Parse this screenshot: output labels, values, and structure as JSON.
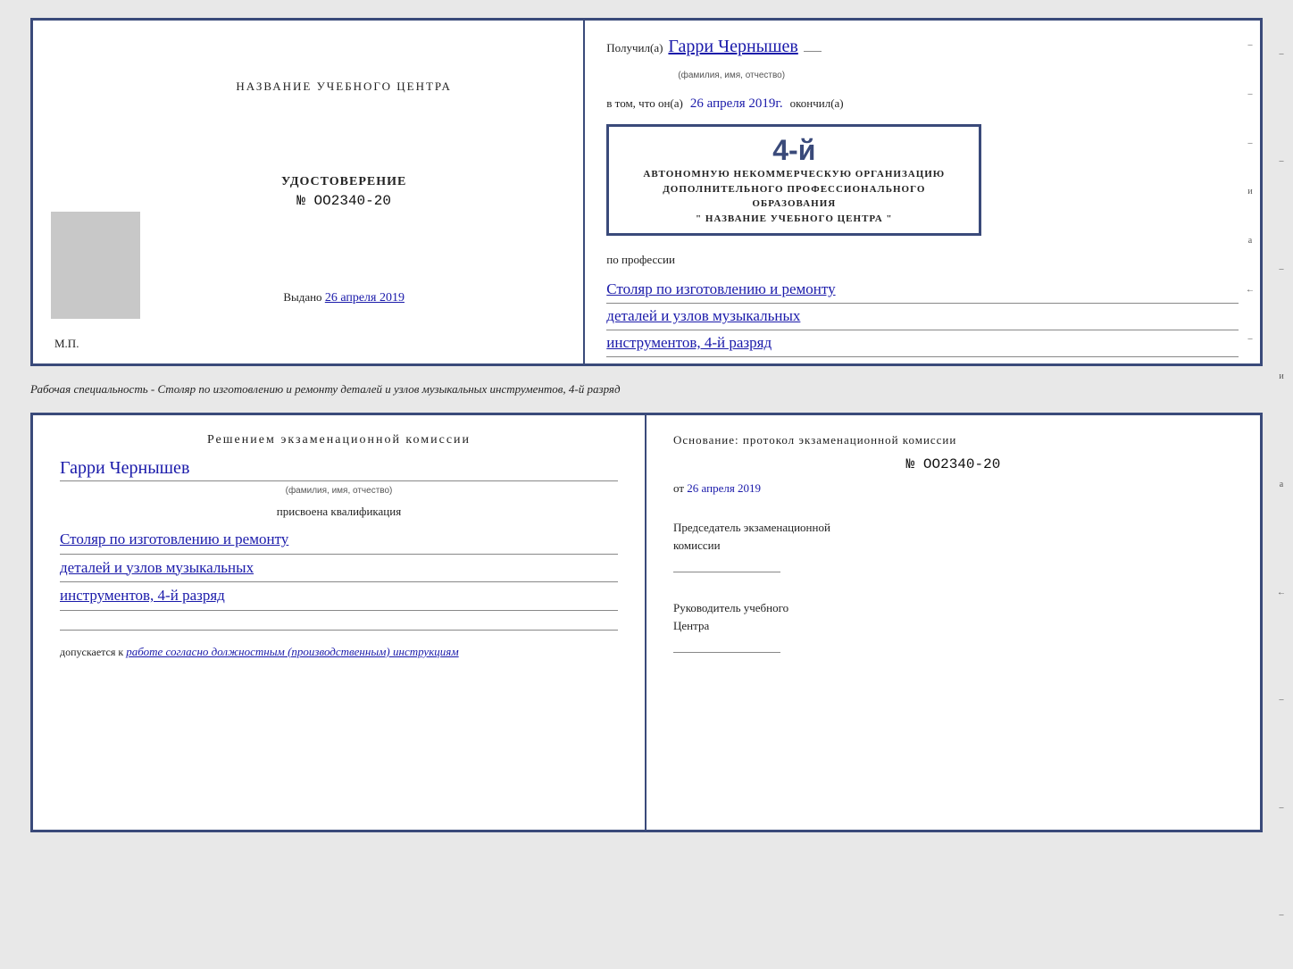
{
  "background_color": "#e8e8e8",
  "top_cert": {
    "left": {
      "center_title": "НАЗВАНИЕ УЧЕБНОГО ЦЕНТРА",
      "photo_alt": "photo placeholder",
      "udostoverenie_label": "УДОСТОВЕРЕНИЕ",
      "number_prefix": "№",
      "number": "OO2340-20",
      "vydano_label": "Выдано",
      "vydano_date": "26 апреля 2019",
      "mp_label": "М.П."
    },
    "right": {
      "poluchil_prefix": "Получил(а)",
      "recipient_name": "Гарри Чернышев",
      "fio_note": "(фамилия, имя, отчество)",
      "vtom_prefix": "в том, что он(а)",
      "vtom_date": "26 апреля 2019г.",
      "okonchil_label": "окончил(а)",
      "stamp_4y": "4-й",
      "stamp_line1": "АВТОНОМНУЮ НЕКОММЕРЧЕСКУЮ ОРГАНИЗАЦИЮ",
      "stamp_line2": "ДОПОЛНИТЕЛЬНОГО ПРОФЕССИОНАЛЬНОГО ОБРАЗОВАНИЯ",
      "stamp_line3": "\" НАЗВАНИЕ УЧЕБНОГО ЦЕНТРА \"",
      "po_professii_label": "по профессии",
      "profession_line1": "Столяр по изготовлению и ремонту",
      "profession_line2": "деталей и узлов музыкальных",
      "profession_line3": "инструментов, 4-й разряд"
    }
  },
  "description": {
    "text": "Рабочая специальность - Столяр по изготовлению и ремонту деталей и узлов музыкальных инструментов, 4-й разряд"
  },
  "bottom_cert": {
    "left": {
      "resolution_title": "Решением  экзаменационной  комиссии",
      "name": "Гарри Чернышев",
      "fio_note": "(фамилия, имя, отчество)",
      "prisvoena_label": "присвоена квалификация",
      "qual_line1": "Столяр по изготовлению и ремонту",
      "qual_line2": "деталей и узлов музыкальных",
      "qual_line3": "инструментов, 4-й разряд",
      "dopuskaetsya_prefix": "допускается к",
      "dopuskaetsya_text": "работе согласно должностным (производственным) инструкциям"
    },
    "right": {
      "osnovanie_label": "Основание: протокол экзаменационной  комиссии",
      "number_prefix": "№",
      "number": "OO2340-20",
      "ot_prefix": "от",
      "ot_date": "26 апреля 2019",
      "predsedatel_line1": "Председатель экзаменационной",
      "predsedatel_line2": "комиссии",
      "rukovoditel_line1": "Руководитель учебного",
      "rukovoditel_line2": "Центра"
    }
  },
  "side_marks": {
    "items": [
      "и",
      "а",
      "←",
      "–",
      "–",
      "–",
      "–",
      "–"
    ]
  }
}
